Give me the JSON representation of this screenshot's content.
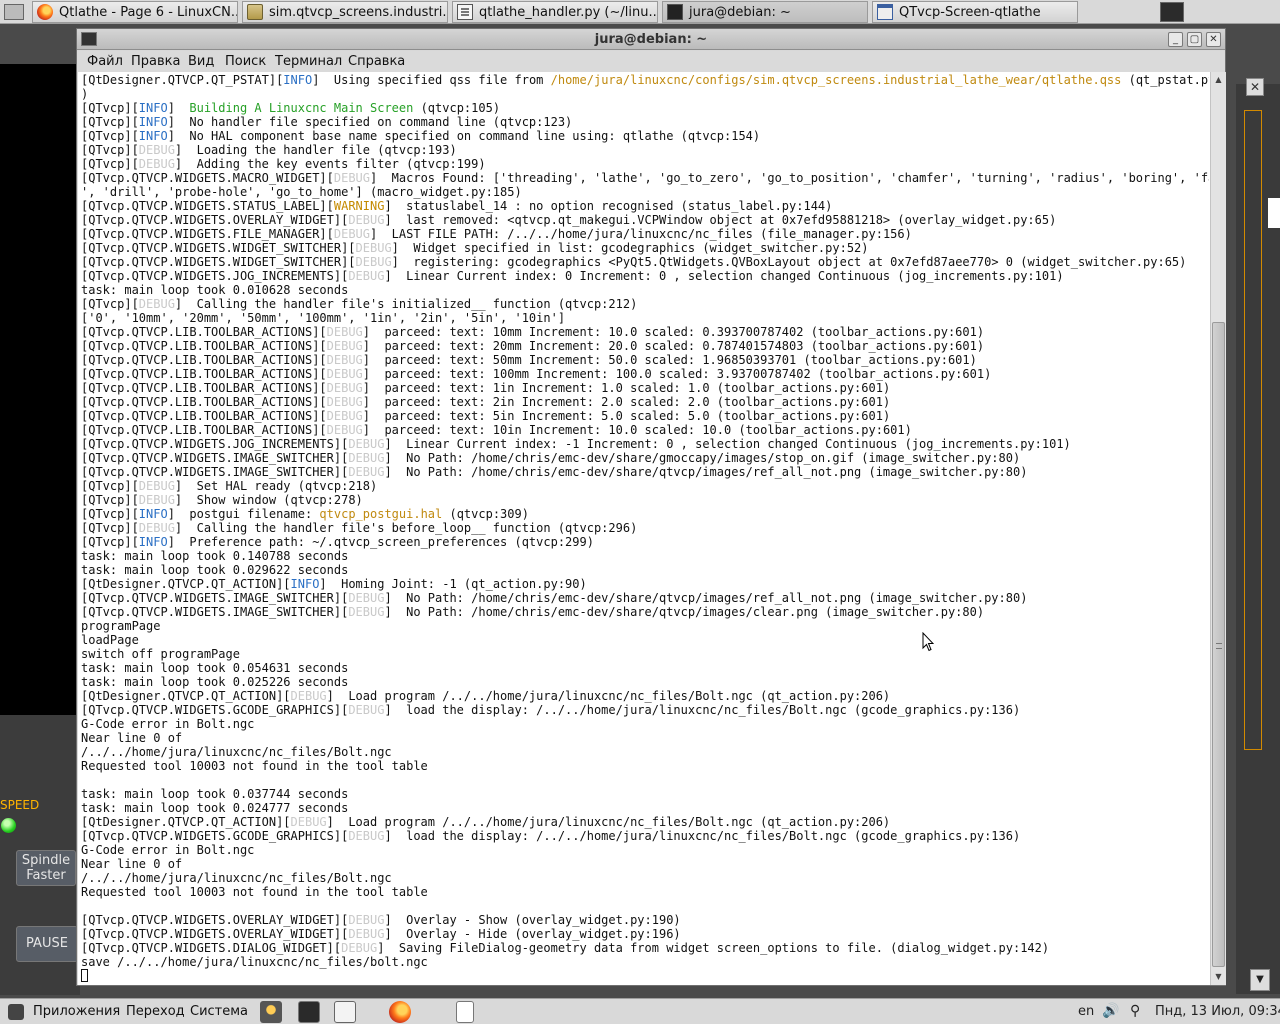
{
  "taskbar": {
    "tasks": [
      {
        "label": "Qtlathe - Page 6 - LinuxCN...",
        "icon": "firefox-icon"
      },
      {
        "label": "sim.qtvcp_screens.industri...",
        "icon": "folder-icon"
      },
      {
        "label": "qtlathe_handler.py (~/linu...",
        "icon": "text-editor-icon"
      },
      {
        "label": "jura@debian: ~",
        "icon": "terminal-icon"
      },
      {
        "label": "QTvcp-Screen-qtlathe",
        "icon": "window-icon"
      }
    ]
  },
  "background_app": {
    "speed_label": "SPEED",
    "spindle_faster_line1": "Spindle",
    "spindle_faster_line2": "Faster",
    "pause_label": "PAUSE",
    "close_glyph": "✕",
    "spin_glyph": "▼",
    "led_color": "#26d020"
  },
  "terminal": {
    "title": "jura@debian: ~",
    "controls": {
      "minimize": "_",
      "maximize": "▢",
      "close": "✕"
    },
    "menu": [
      "Файл",
      "Правка",
      "Вид",
      "Поиск",
      "Терминал",
      "Справка"
    ],
    "lines": [
      [
        [
          "[QtDesigner.QTVCP.QT_PSTAT][",
          ""
        ],
        [
          "INFO",
          "info"
        ],
        [
          "]  Using specified qss file from ",
          ""
        ],
        [
          "/home/jura/linuxcnc/configs/sim.qtvcp_screens.industrial_lathe_wear/qtlathe.qss",
          "path"
        ],
        [
          " (qt_pstat.py:143",
          ""
        ]
      ],
      [
        [
          ")",
          ""
        ]
      ],
      [
        [
          "[QTvcp][",
          ""
        ],
        [
          "INFO",
          "info"
        ],
        [
          "]  ",
          ""
        ],
        [
          "Building A Linuxcnc Main Screen",
          "green"
        ],
        [
          " (qtvcp:105)",
          ""
        ]
      ],
      [
        [
          "[QTvcp][",
          ""
        ],
        [
          "INFO",
          "info"
        ],
        [
          "]  No handler file specified on command line (qtvcp:123)",
          ""
        ]
      ],
      [
        [
          "[QTvcp][",
          ""
        ],
        [
          "INFO",
          "info"
        ],
        [
          "]  No HAL component base name specified on command line using: qtlathe (qtvcp:154)",
          ""
        ]
      ],
      [
        [
          "[QTvcp][",
          ""
        ],
        [
          "DEBUG",
          "debug"
        ],
        [
          "]  Loading the handler file (qtvcp:193)",
          ""
        ]
      ],
      [
        [
          "[QTvcp][",
          ""
        ],
        [
          "DEBUG",
          "debug"
        ],
        [
          "]  Adding the key events filter (qtvcp:199)",
          ""
        ]
      ],
      [
        [
          "[QTvcp.QTVCP.WIDGETS.MACRO_WIDGET][",
          ""
        ],
        [
          "DEBUG",
          "debug"
        ],
        [
          "]  Macros Found: ['threading', 'lathe', 'go_to_zero', 'go_to_position', 'chamfer', 'turning', 'radius', 'boring', 'facing",
          ""
        ]
      ],
      [
        [
          "', 'drill', 'probe-hole', 'go_to_home'] (macro_widget.py:185)",
          ""
        ]
      ],
      [
        [
          "[QTvcp.QTVCP.WIDGETS.STATUS_LABEL][",
          ""
        ],
        [
          "WARNING",
          "warn"
        ],
        [
          "]  statuslabel_14 : no option recognised (status_label.py:144)",
          ""
        ]
      ],
      [
        [
          "[QTvcp.QTVCP.WIDGETS.OVERLAY_WIDGET][",
          ""
        ],
        [
          "DEBUG",
          "debug"
        ],
        [
          "]  last removed: <qtvcp.qt_makegui.VCPWindow object at 0x7efd95881218> (overlay_widget.py:65)",
          ""
        ]
      ],
      [
        [
          "[QTvcp.QTVCP.WIDGETS.FILE_MANAGER][",
          ""
        ],
        [
          "DEBUG",
          "debug"
        ],
        [
          "]  LAST FILE PATH: /../../home/jura/linuxcnc/nc_files (file_manager.py:156)",
          ""
        ]
      ],
      [
        [
          "[QTvcp.QTVCP.WIDGETS.WIDGET_SWITCHER][",
          ""
        ],
        [
          "DEBUG",
          "debug"
        ],
        [
          "]  Widget specified in list: gcodegraphics (widget_switcher.py:52)",
          ""
        ]
      ],
      [
        [
          "[QTvcp.QTVCP.WIDGETS.WIDGET_SWITCHER][",
          ""
        ],
        [
          "DEBUG",
          "debug"
        ],
        [
          "]  registering: gcodegraphics <PyQt5.QtWidgets.QVBoxLayout object at 0x7efd87aee770> 0 (widget_switcher.py:65)",
          ""
        ]
      ],
      [
        [
          "[QTvcp.QTVCP.WIDGETS.JOG_INCREMENTS][",
          ""
        ],
        [
          "DEBUG",
          "debug"
        ],
        [
          "]  Linear Current index: 0 Increment: 0 , selection changed Continuous (jog_increments.py:101)",
          ""
        ]
      ],
      [
        [
          "task: main loop took 0.010628 seconds",
          ""
        ]
      ],
      [
        [
          "[QTvcp][",
          ""
        ],
        [
          "DEBUG",
          "debug"
        ],
        [
          "]  Calling the handler file's initialized__ function (qtvcp:212)",
          ""
        ]
      ],
      [
        [
          "['0', '10mm', '20mm', '50mm', '100mm', '1in', '2in', '5in', '10in']",
          ""
        ]
      ],
      [
        [
          "[QTvcp.QTVCP.LIB.TOOLBAR_ACTIONS][",
          ""
        ],
        [
          "DEBUG",
          "debug"
        ],
        [
          "]  parceed: text: 10mm Increment: 10.0 scaled: 0.393700787402 (toolbar_actions.py:601)",
          ""
        ]
      ],
      [
        [
          "[QTvcp.QTVCP.LIB.TOOLBAR_ACTIONS][",
          ""
        ],
        [
          "DEBUG",
          "debug"
        ],
        [
          "]  parceed: text: 20mm Increment: 20.0 scaled: 0.787401574803 (toolbar_actions.py:601)",
          ""
        ]
      ],
      [
        [
          "[QTvcp.QTVCP.LIB.TOOLBAR_ACTIONS][",
          ""
        ],
        [
          "DEBUG",
          "debug"
        ],
        [
          "]  parceed: text: 50mm Increment: 50.0 scaled: 1.96850393701 (toolbar_actions.py:601)",
          ""
        ]
      ],
      [
        [
          "[QTvcp.QTVCP.LIB.TOOLBAR_ACTIONS][",
          ""
        ],
        [
          "DEBUG",
          "debug"
        ],
        [
          "]  parceed: text: 100mm Increment: 100.0 scaled: 3.93700787402 (toolbar_actions.py:601)",
          ""
        ]
      ],
      [
        [
          "[QTvcp.QTVCP.LIB.TOOLBAR_ACTIONS][",
          ""
        ],
        [
          "DEBUG",
          "debug"
        ],
        [
          "]  parceed: text: 1in Increment: 1.0 scaled: 1.0 (toolbar_actions.py:601)",
          ""
        ]
      ],
      [
        [
          "[QTvcp.QTVCP.LIB.TOOLBAR_ACTIONS][",
          ""
        ],
        [
          "DEBUG",
          "debug"
        ],
        [
          "]  parceed: text: 2in Increment: 2.0 scaled: 2.0 (toolbar_actions.py:601)",
          ""
        ]
      ],
      [
        [
          "[QTvcp.QTVCP.LIB.TOOLBAR_ACTIONS][",
          ""
        ],
        [
          "DEBUG",
          "debug"
        ],
        [
          "]  parceed: text: 5in Increment: 5.0 scaled: 5.0 (toolbar_actions.py:601)",
          ""
        ]
      ],
      [
        [
          "[QTvcp.QTVCP.LIB.TOOLBAR_ACTIONS][",
          ""
        ],
        [
          "DEBUG",
          "debug"
        ],
        [
          "]  parceed: text: 10in Increment: 10.0 scaled: 10.0 (toolbar_actions.py:601)",
          ""
        ]
      ],
      [
        [
          "[QTvcp.QTVCP.WIDGETS.JOG_INCREMENTS][",
          ""
        ],
        [
          "DEBUG",
          "debug"
        ],
        [
          "]  Linear Current index: -1 Increment: 0 , selection changed Continuous (jog_increments.py:101)",
          ""
        ]
      ],
      [
        [
          "[QTvcp.QTVCP.WIDGETS.IMAGE_SWITCHER][",
          ""
        ],
        [
          "DEBUG",
          "debug"
        ],
        [
          "]  No Path: /home/chris/emc-dev/share/gmoccapy/images/stop_on.gif (image_switcher.py:80)",
          ""
        ]
      ],
      [
        [
          "[QTvcp.QTVCP.WIDGETS.IMAGE_SWITCHER][",
          ""
        ],
        [
          "DEBUG",
          "debug"
        ],
        [
          "]  No Path: /home/chris/emc-dev/share/qtvcp/images/ref_all_not.png (image_switcher.py:80)",
          ""
        ]
      ],
      [
        [
          "[QTvcp][",
          ""
        ],
        [
          "DEBUG",
          "debug"
        ],
        [
          "]  Set HAL ready (qtvcp:218)",
          ""
        ]
      ],
      [
        [
          "[QTvcp][",
          ""
        ],
        [
          "DEBUG",
          "debug"
        ],
        [
          "]  Show window (qtvcp:278)",
          ""
        ]
      ],
      [
        [
          "[QTvcp][",
          ""
        ],
        [
          "INFO",
          "info"
        ],
        [
          "]  postgui filename: ",
          ""
        ],
        [
          "qtvcp_postgui.hal",
          "path"
        ],
        [
          " (qtvcp:309)",
          ""
        ]
      ],
      [
        [
          "[QTvcp][",
          ""
        ],
        [
          "DEBUG",
          "debug"
        ],
        [
          "]  Calling the handler file's before_loop__ function (qtvcp:296)",
          ""
        ]
      ],
      [
        [
          "[QTvcp][",
          ""
        ],
        [
          "INFO",
          "info"
        ],
        [
          "]  Preference path: ~/.qtvcp_screen_preferences (qtvcp:299)",
          ""
        ]
      ],
      [
        [
          "task: main loop took 0.140788 seconds",
          ""
        ]
      ],
      [
        [
          "task: main loop took 0.029622 seconds",
          ""
        ]
      ],
      [
        [
          "[QtDesigner.QTVCP.QT_ACTION][",
          ""
        ],
        [
          "INFO",
          "info"
        ],
        [
          "]  Homing Joint: -1 (qt_action.py:90)",
          ""
        ]
      ],
      [
        [
          "[QTvcp.QTVCP.WIDGETS.IMAGE_SWITCHER][",
          ""
        ],
        [
          "DEBUG",
          "debug"
        ],
        [
          "]  No Path: /home/chris/emc-dev/share/qtvcp/images/ref_all_not.png (image_switcher.py:80)",
          ""
        ]
      ],
      [
        [
          "[QTvcp.QTVCP.WIDGETS.IMAGE_SWITCHER][",
          ""
        ],
        [
          "DEBUG",
          "debug"
        ],
        [
          "]  No Path: /home/chris/emc-dev/share/qtvcp/images/clear.png (image_switcher.py:80)",
          ""
        ]
      ],
      [
        [
          "programPage",
          ""
        ]
      ],
      [
        [
          "loadPage",
          ""
        ]
      ],
      [
        [
          "switch off programPage",
          ""
        ]
      ],
      [
        [
          "task: main loop took 0.054631 seconds",
          ""
        ]
      ],
      [
        [
          "task: main loop took 0.025226 seconds",
          ""
        ]
      ],
      [
        [
          "[QtDesigner.QTVCP.QT_ACTION][",
          ""
        ],
        [
          "DEBUG",
          "debug"
        ],
        [
          "]  Load program /../../home/jura/linuxcnc/nc_files/Bolt.ngc (qt_action.py:206)",
          ""
        ]
      ],
      [
        [
          "[QTvcp.QTVCP.WIDGETS.GCODE_GRAPHICS][",
          ""
        ],
        [
          "DEBUG",
          "debug"
        ],
        [
          "]  load the display: /../../home/jura/linuxcnc/nc_files/Bolt.ngc (gcode_graphics.py:136)",
          ""
        ]
      ],
      [
        [
          "G-Code error in Bolt.ngc",
          ""
        ]
      ],
      [
        [
          "Near line 0 of",
          ""
        ]
      ],
      [
        [
          "/../../home/jura/linuxcnc/nc_files/Bolt.ngc",
          ""
        ]
      ],
      [
        [
          "Requested tool 10003 not found in the tool table",
          ""
        ]
      ],
      [
        [
          "",
          ""
        ]
      ],
      [
        [
          "task: main loop took 0.037744 seconds",
          ""
        ]
      ],
      [
        [
          "task: main loop took 0.024777 seconds",
          ""
        ]
      ],
      [
        [
          "[QtDesigner.QTVCP.QT_ACTION][",
          ""
        ],
        [
          "DEBUG",
          "debug"
        ],
        [
          "]  Load program /../../home/jura/linuxcnc/nc_files/Bolt.ngc (qt_action.py:206)",
          ""
        ]
      ],
      [
        [
          "[QTvcp.QTVCP.WIDGETS.GCODE_GRAPHICS][",
          ""
        ],
        [
          "DEBUG",
          "debug"
        ],
        [
          "]  load the display: /../../home/jura/linuxcnc/nc_files/Bolt.ngc (gcode_graphics.py:136)",
          ""
        ]
      ],
      [
        [
          "G-Code error in Bolt.ngc",
          ""
        ]
      ],
      [
        [
          "Near line 0 of",
          ""
        ]
      ],
      [
        [
          "/../../home/jura/linuxcnc/nc_files/Bolt.ngc",
          ""
        ]
      ],
      [
        [
          "Requested tool 10003 not found in the tool table",
          ""
        ]
      ],
      [
        [
          "",
          ""
        ]
      ],
      [
        [
          "[QTvcp.QTVCP.WIDGETS.OVERLAY_WIDGET][",
          ""
        ],
        [
          "DEBUG",
          "debug"
        ],
        [
          "]  Overlay - Show (overlay_widget.py:190)",
          ""
        ]
      ],
      [
        [
          "[QTvcp.QTVCP.WIDGETS.OVERLAY_WIDGET][",
          ""
        ],
        [
          "DEBUG",
          "debug"
        ],
        [
          "]  Overlay - Hide (overlay_widget.py:196)",
          ""
        ]
      ],
      [
        [
          "[QTvcp.QTVCP.WIDGETS.DIALOG_WIDGET][",
          ""
        ],
        [
          "DEBUG",
          "debug"
        ],
        [
          "]  Saving FileDialog-geometry data from widget screen_options to file. (dialog_widget.py:142)",
          ""
        ]
      ],
      [
        [
          "save /../../home/jura/linuxcnc/nc_files/bolt.ngc",
          ""
        ]
      ]
    ],
    "colors": {
      "info": "#2a6fc4",
      "debug": "#c9c9c9",
      "warning": "#c48a00",
      "path": "#c08a10",
      "green": "#27a127"
    },
    "scroll_up_glyph": "▲",
    "scroll_down_glyph": "▼"
  },
  "bottom_panel": {
    "menus": [
      "Приложения",
      "Переход",
      "Система"
    ],
    "language": "en",
    "sound_glyph": "🔊",
    "network_glyph": "⚲",
    "clock": "Пнд, 13 Июл, 09:34"
  }
}
